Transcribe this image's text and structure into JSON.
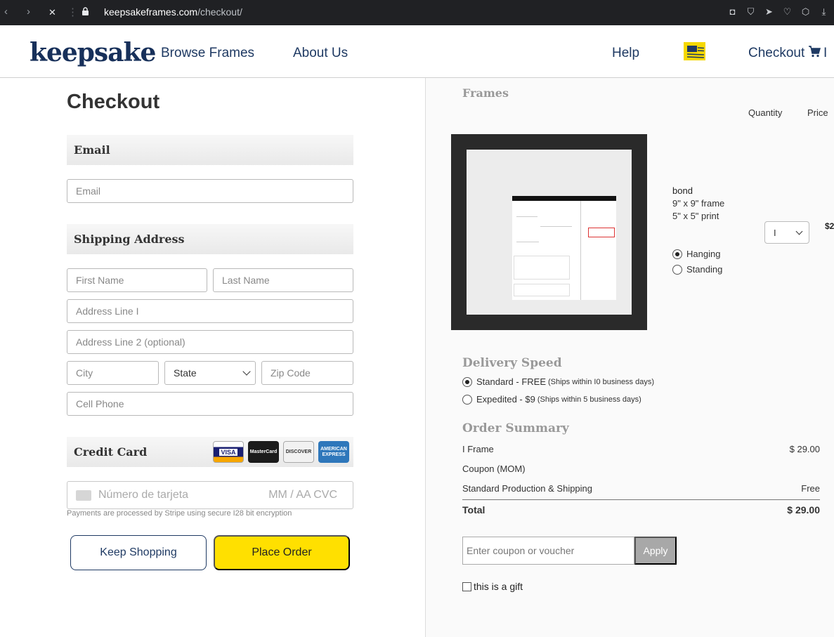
{
  "browser": {
    "back": "‹",
    "forward": "›",
    "stop": "✕",
    "url_domain": "keepsakeframes.com",
    "url_path": "/checkout/"
  },
  "header": {
    "logo": "keepsake",
    "nav": [
      "Browse Frames",
      "About Us"
    ],
    "help": "Help",
    "checkout": "Checkout",
    "cart_count": "I"
  },
  "checkout": {
    "title": "Checkout",
    "email_section": "Email",
    "email_placeholder": "Email",
    "shipping_section": "Shipping Address",
    "first_name": "First Name",
    "last_name": "Last Name",
    "address1": "Address Line I",
    "address2": "Address Line 2 (optional)",
    "city": "City",
    "state": "State",
    "zip": "Zip Code",
    "phone": "Cell Phone",
    "credit_section": "Credit Card",
    "cards": [
      "VISA",
      "MasterCard",
      "DISCOVER",
      "AMERICAN EXPRESS"
    ],
    "card_number": "Número de tarjeta",
    "card_exp_cvc": "MM / AA  CVC",
    "payment_note": "Payments are processed by Stripe using secure I28 bit encryption",
    "keep_shopping": "Keep Shopping",
    "place_order": "Place Order"
  },
  "cart": {
    "frames_heading": "Frames",
    "quantity_head": "Quantity",
    "price_head": "Price",
    "item_name": "bond",
    "item_frame": "9\" x 9\" frame",
    "item_print": "5\" x 5\" print",
    "mount_options": [
      {
        "label": "Hanging",
        "selected": true
      },
      {
        "label": "Standing",
        "selected": false
      }
    ],
    "quantity": "I",
    "price_partial": "$2"
  },
  "delivery": {
    "heading": "Delivery Speed",
    "options": [
      {
        "label": "Standard - FREE",
        "note": "(Ships within I0 business days)",
        "selected": true
      },
      {
        "label": "Expedited - $9",
        "note": "(Ships within 5 business days)",
        "selected": false
      }
    ]
  },
  "summary": {
    "heading": "Order Summary",
    "rows": [
      {
        "label": "I Frame",
        "value": "$ 29.00"
      },
      {
        "label": "Coupon (MOM)",
        "value": ""
      },
      {
        "label": "Standard Production & Shipping",
        "value": "Free"
      }
    ],
    "total_label": "Total",
    "total_value": "$ 29.00",
    "coupon_placeholder": "Enter coupon or voucher",
    "apply": "Apply",
    "gift": "this is a gift"
  }
}
